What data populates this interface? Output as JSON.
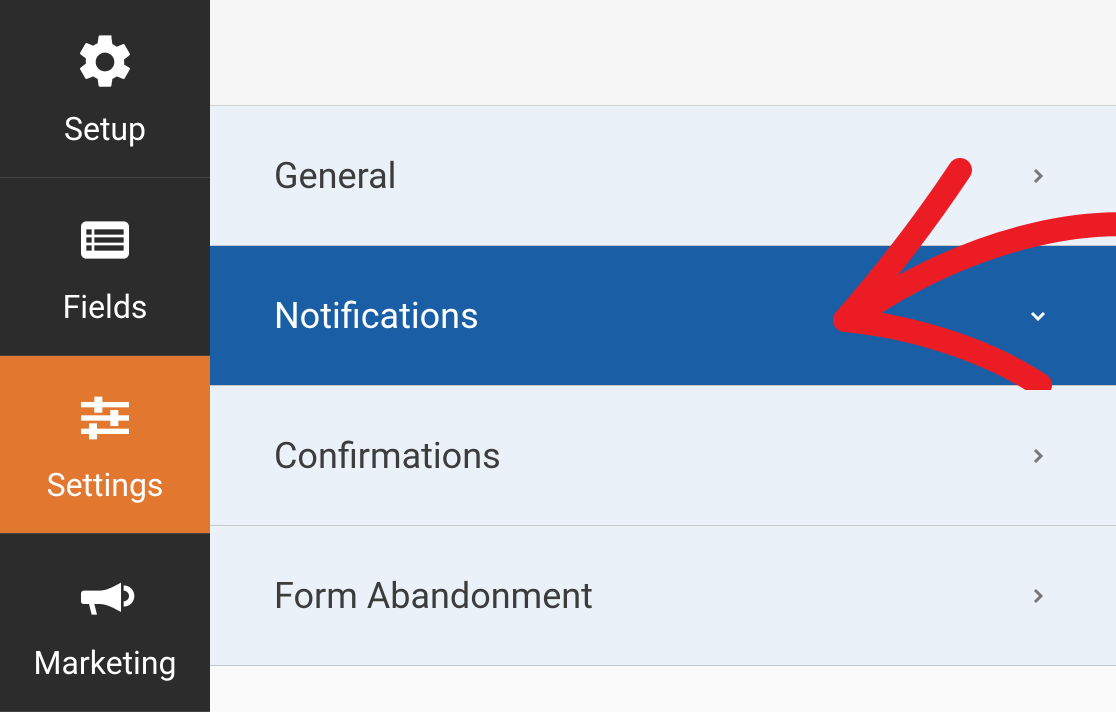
{
  "sidebar": {
    "items": [
      {
        "label": "Setup",
        "icon": "gear-icon",
        "active": false
      },
      {
        "label": "Fields",
        "icon": "list-icon",
        "active": false
      },
      {
        "label": "Settings",
        "icon": "sliders-icon",
        "active": true
      },
      {
        "label": "Marketing",
        "icon": "bullhorn-icon",
        "active": false
      }
    ]
  },
  "panels": {
    "items": [
      {
        "label": "General",
        "selected": false,
        "expanded": false
      },
      {
        "label": "Notifications",
        "selected": true,
        "expanded": true
      },
      {
        "label": "Confirmations",
        "selected": false,
        "expanded": false
      },
      {
        "label": "Form Abandonment",
        "selected": false,
        "expanded": false
      }
    ]
  },
  "colors": {
    "sidebar_bg": "#2c2c2c",
    "active_nav": "#e27730",
    "selected_panel": "#1a5fa6",
    "panel_bg": "#eaf1f9",
    "annotation": "#ec1c24"
  }
}
